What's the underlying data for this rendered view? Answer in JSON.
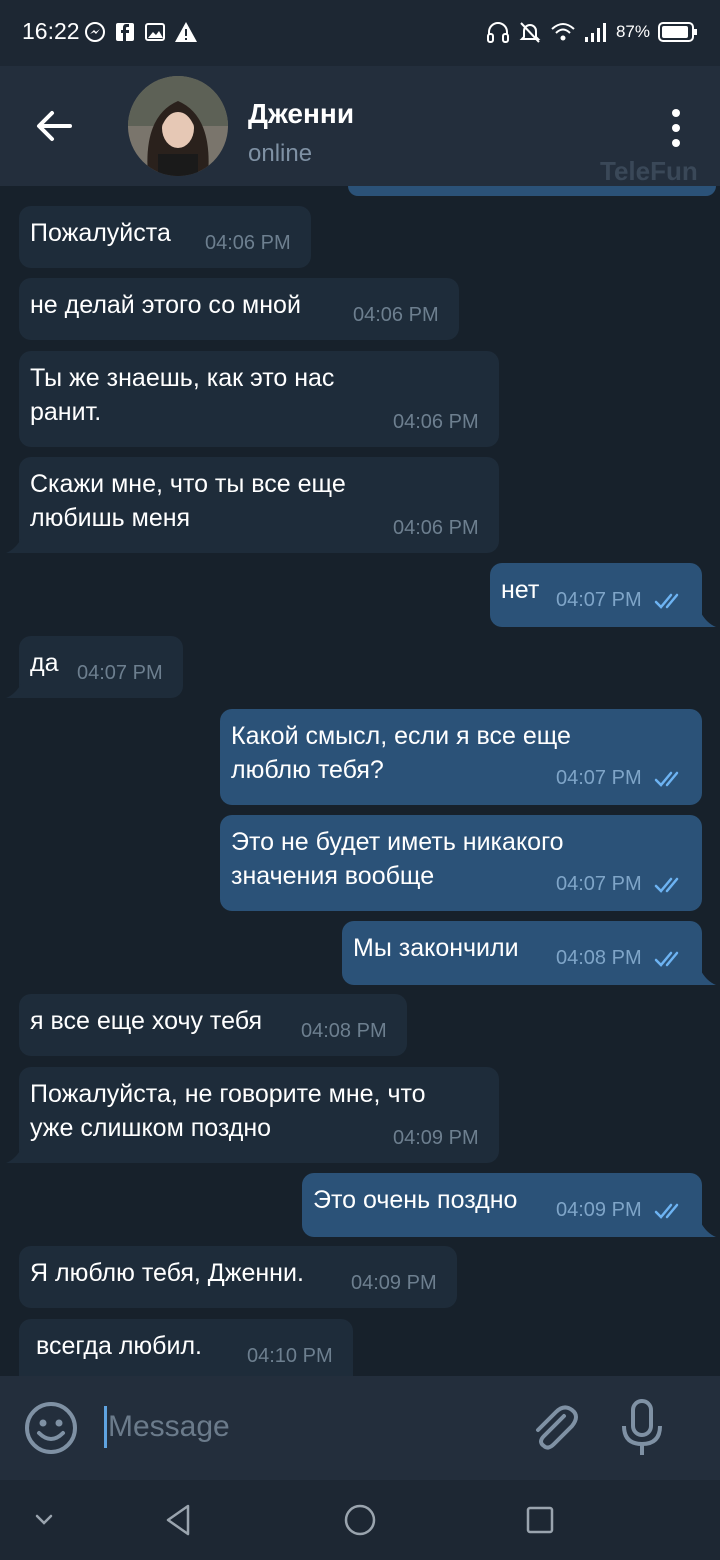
{
  "status_bar": {
    "time": "16:22",
    "battery": "87%"
  },
  "header": {
    "name": "Дженни",
    "status": "online",
    "watermark": "TeleFun"
  },
  "messages": [
    {
      "dir": "in",
      "text": "Пожалуйста",
      "time": "04:06 PM"
    },
    {
      "dir": "in",
      "text": "не делай этого со мной",
      "time": "04:06 PM"
    },
    {
      "dir": "in",
      "text": "Ты же знаешь, как это нас\nранит.",
      "time": "04:06 PM"
    },
    {
      "dir": "in",
      "text": "Скажи мне, что ты все еще\nлюбишь меня",
      "time": "04:06 PM"
    },
    {
      "dir": "out",
      "text": "нет",
      "time": "04:07 PM"
    },
    {
      "dir": "in",
      "text": "да",
      "time": "04:07 PM"
    },
    {
      "dir": "out",
      "text": "Какой смысл, если я все еще\nлюблю тебя?",
      "time": "04:07 PM"
    },
    {
      "dir": "out",
      "text": "Это не будет иметь никакого\nзначения вообще",
      "time": "04:07 PM"
    },
    {
      "dir": "out",
      "text": "Мы закончили",
      "time": "04:08 PM"
    },
    {
      "dir": "in",
      "text": "я все еще хочу тебя",
      "time": "04:08 PM"
    },
    {
      "dir": "in",
      "text": "Пожалуйста, не говорите мне, что\nуже слишком поздно",
      "time": "04:09 PM"
    },
    {
      "dir": "out",
      "text": "Это очень поздно",
      "time": "04:09 PM"
    },
    {
      "dir": "in",
      "text": "Я люблю тебя, Дженни.",
      "time": "04:09 PM"
    },
    {
      "dir": "in",
      "text": "всегда любил.",
      "time": "04:10 PM"
    }
  ],
  "input": {
    "placeholder": "Message"
  },
  "colors": {
    "incoming": "#1e2c3a",
    "outgoing": "#2b5278",
    "background": "#17212b",
    "accent": "#5fa3e0"
  },
  "icons": [
    "back-arrow-icon",
    "more-vertical-icon",
    "emoji-icon",
    "attach-icon",
    "microphone-icon",
    "double-check-icon"
  ]
}
